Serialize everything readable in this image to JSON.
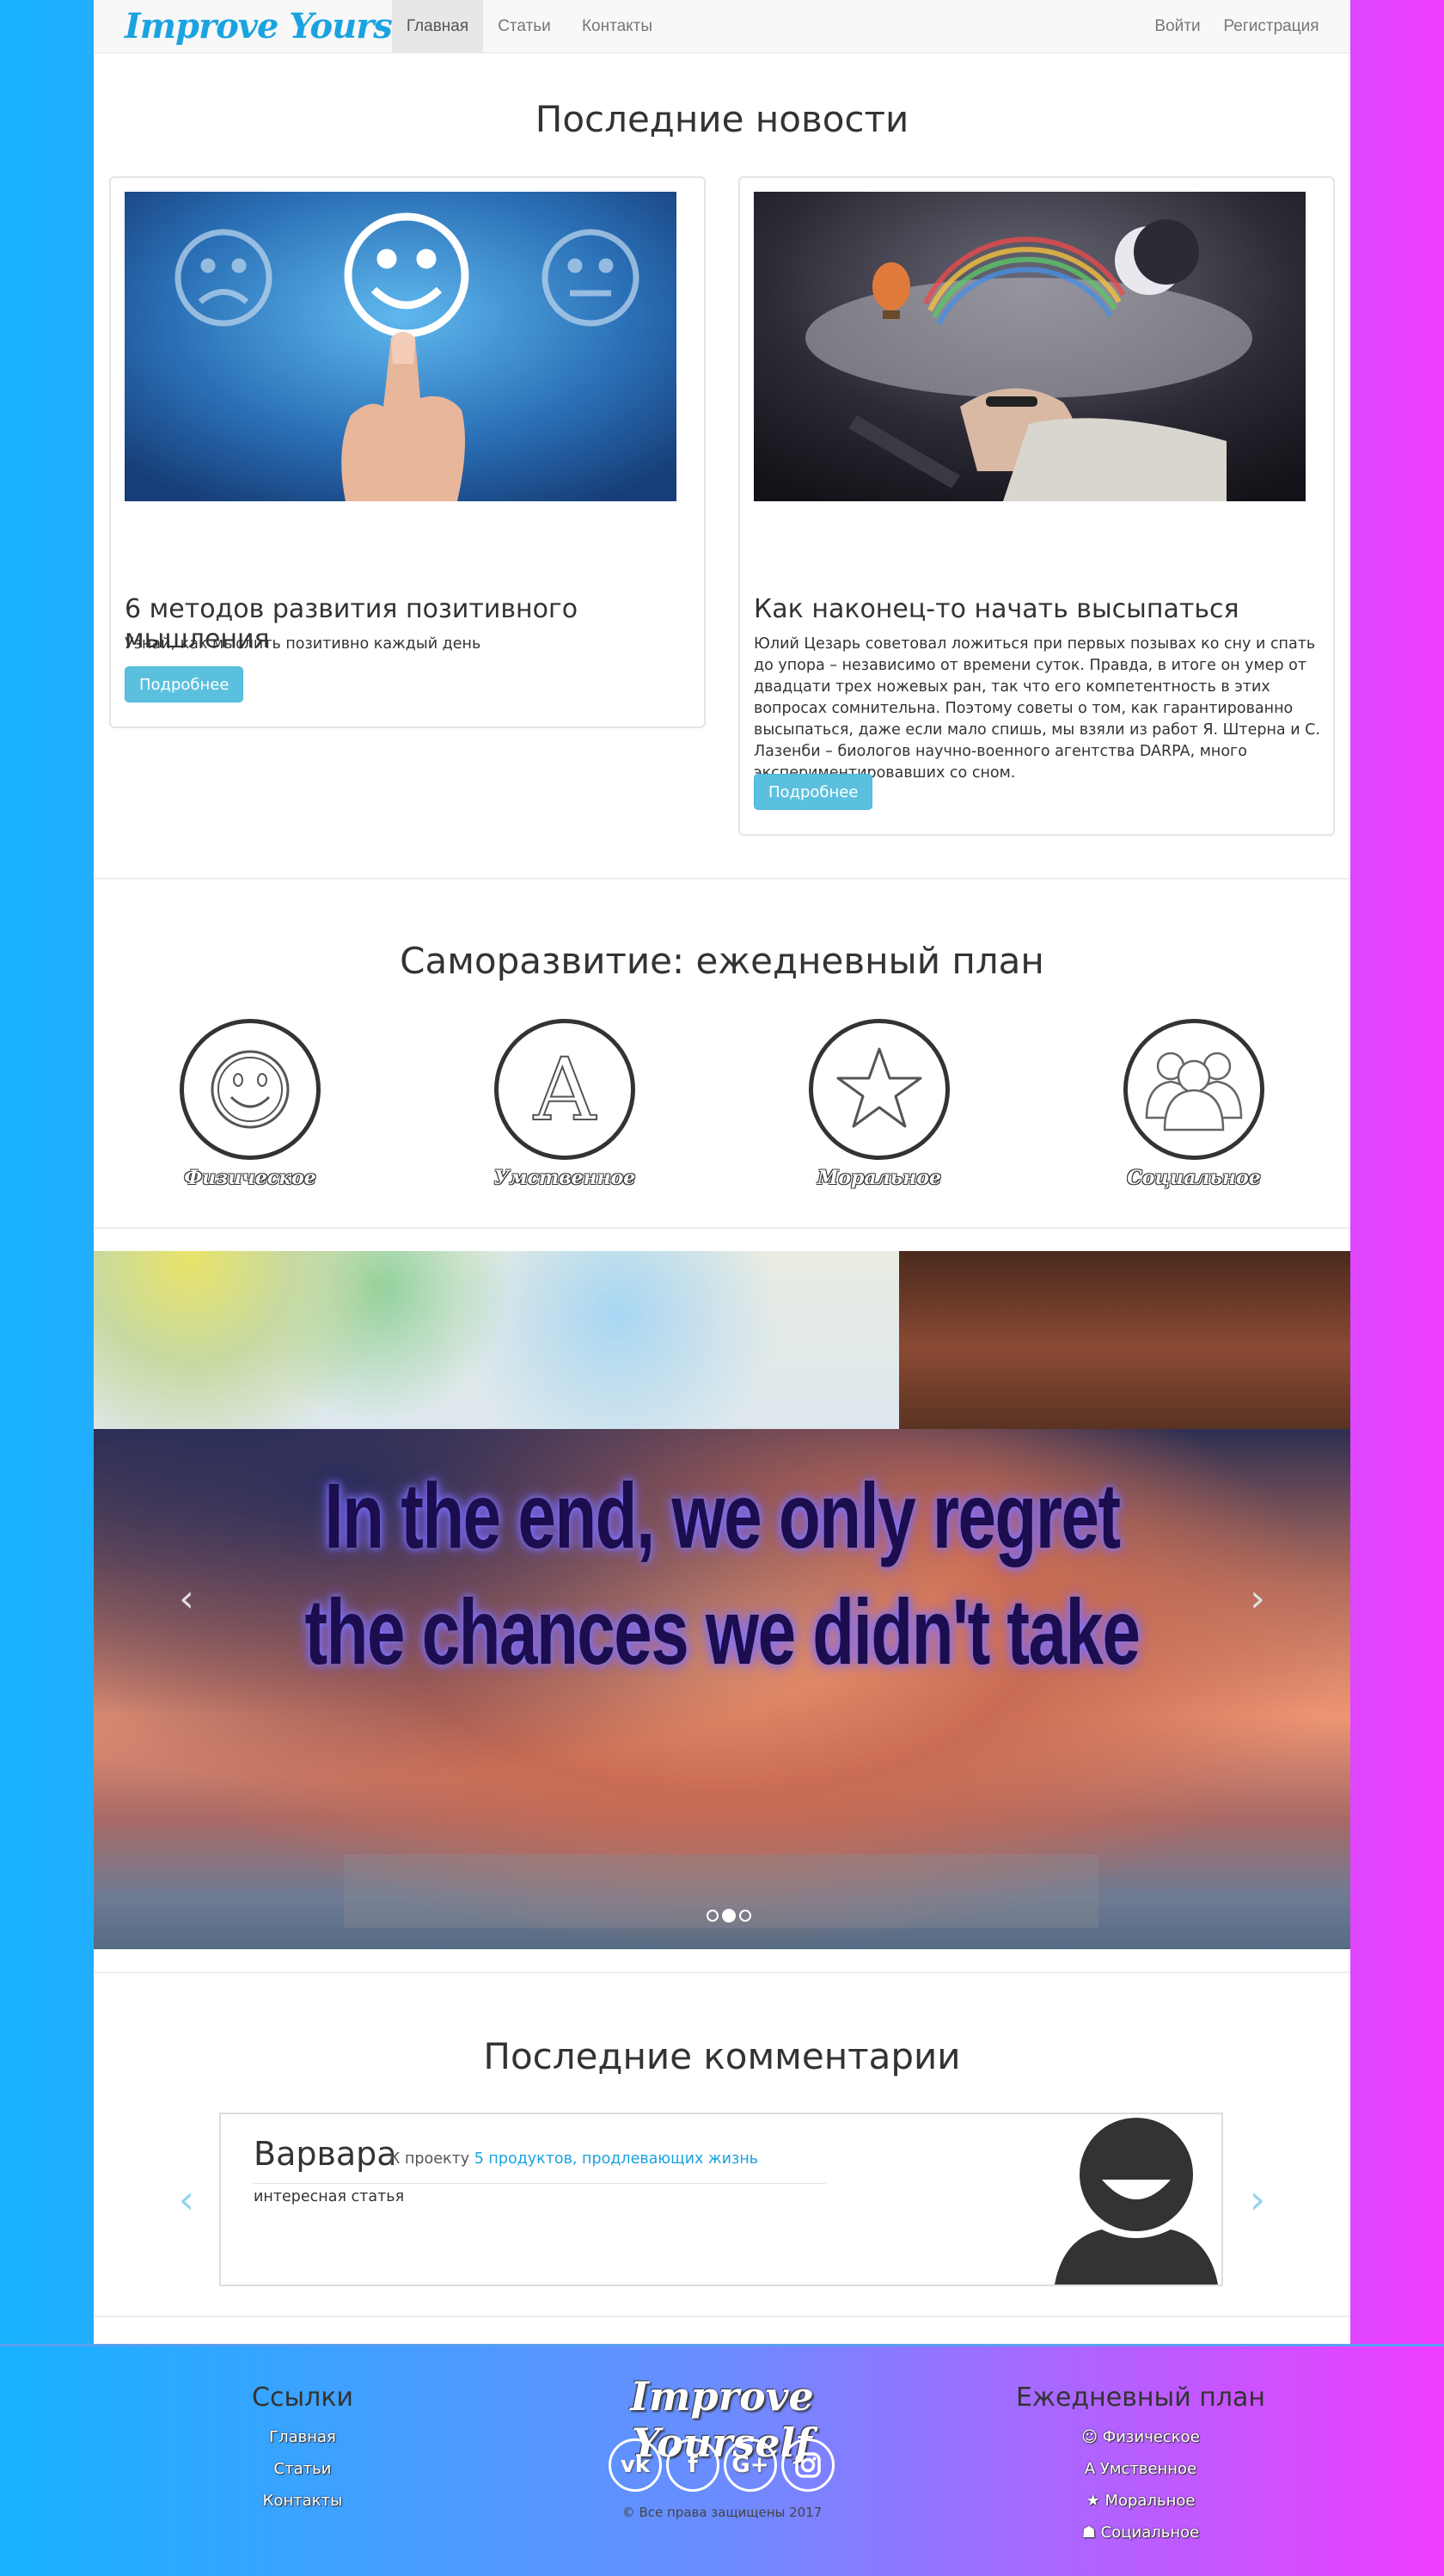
{
  "colors": {
    "accent": "#1aa3e0",
    "button": "#5bc0de",
    "bg_left": "#17b3ff",
    "bg_right": "#f03cff"
  },
  "navbar": {
    "brand": "Improve Yourself",
    "links": [
      {
        "label": "Главная",
        "active": true
      },
      {
        "label": "Статьи"
      },
      {
        "label": "Контакты"
      }
    ],
    "right_links": [
      {
        "label": "Войти"
      },
      {
        "label": "Регистрация"
      }
    ]
  },
  "news": {
    "title": "Последние новости",
    "cards": [
      {
        "title": "6 методов развития позитивного мышления",
        "text": "Узнай, как мыслить позитивно каждый день",
        "button": "Подробнее",
        "image": "smiley-finger-image"
      },
      {
        "title": "Как наконец-то начать высыпаться",
        "text": "Юлий Цезарь советовал ложиться при первых позывах ко сну и спать до упора – независимо от времени суток. Правда, в итоге он умер от двадцати трех ножевых ран, так что его компетентность в этих вопросах сомнительна. Поэтому советы о том, как гарантированно высыпаться, даже если мало спишь, мы взяли из работ Я. Штерна и С. Лазенби – биологов научно-военного агентства DARPA, много экспериментировавших со сном.",
        "button": "Подробнее",
        "image": "sleeping-man-laptop-image"
      }
    ]
  },
  "plan": {
    "title": "Саморазвитие: ежедневный план",
    "items": [
      {
        "label": "Физическое",
        "icon": "smiley-icon"
      },
      {
        "label": "Умственное",
        "icon": "letter-a-icon"
      },
      {
        "label": "Моральное",
        "icon": "star-icon"
      },
      {
        "label": "Социальное",
        "icon": "group-icon"
      }
    ]
  },
  "carousel": {
    "quote_line1": "In the end, we only regret",
    "quote_line2": "the chances we didn't take",
    "prev": "‹",
    "next": "›",
    "slides": 3,
    "active_slide": 2
  },
  "comments": {
    "title": "Последние комментарии",
    "items": [
      {
        "author": "Варвара",
        "ref_prefix": "К проекту",
        "ref_link": "5 продуктов, продлевающих жизнь",
        "text": "интересная статья",
        "avatar": "avatar-icon"
      }
    ],
    "prev": "‹",
    "next": "›"
  },
  "footer": {
    "links_heading": "Ссылки",
    "links": [
      "Главная",
      "Статьи",
      "Контакты"
    ],
    "brand": "Improve Yourself",
    "social": [
      {
        "icon": "vk-icon",
        "glyph": "vk"
      },
      {
        "icon": "facebook-icon",
        "glyph": "f"
      },
      {
        "icon": "google-plus-icon",
        "glyph": "G+"
      },
      {
        "icon": "instagram-icon",
        "glyph": ""
      }
    ],
    "copyright": "© Все права защищены 2017",
    "plan_heading": "Ежедневный план",
    "plan_links": [
      {
        "glyph": "☺",
        "label": "Физическое"
      },
      {
        "glyph": "A",
        "label": "Умственное"
      },
      {
        "glyph": "★",
        "label": "Моральное"
      },
      {
        "glyph": "☗",
        "label": "Социальное"
      }
    ]
  }
}
